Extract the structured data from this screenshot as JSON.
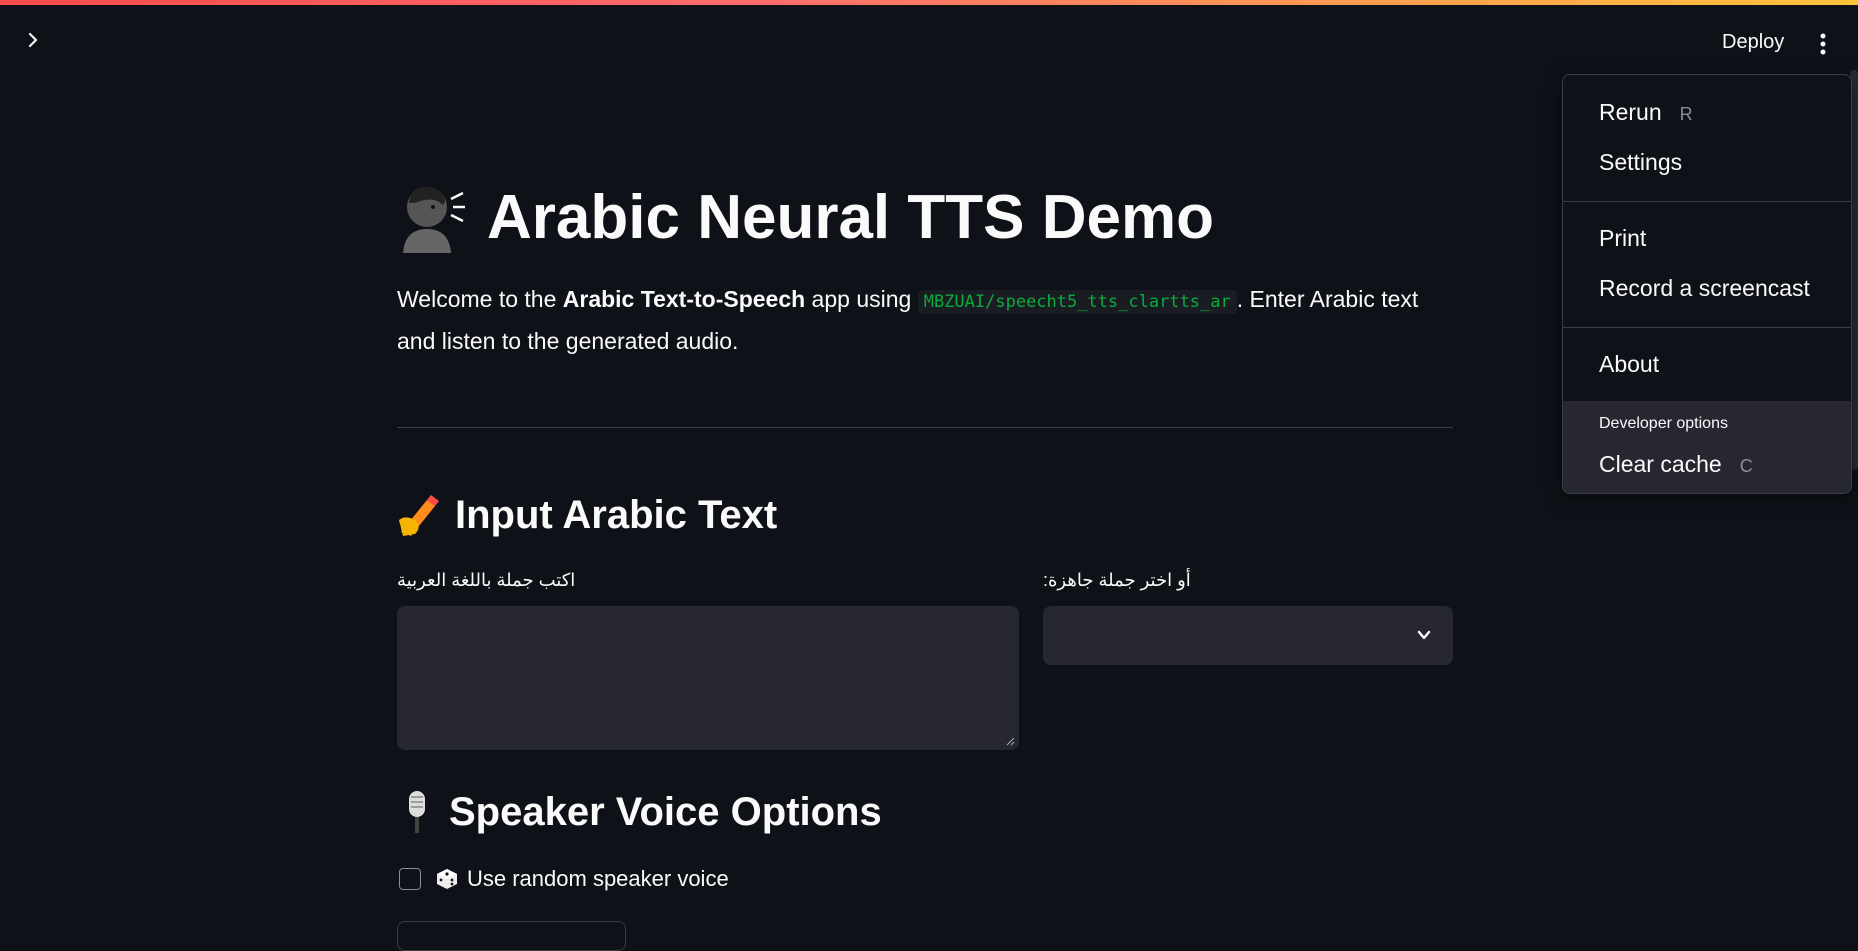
{
  "header": {
    "deploy_label": "Deploy",
    "sidebar_toggle_icon": "chevron-right-icon",
    "menu_icon": "kebab-menu-icon"
  },
  "main": {
    "title_emoji": "speaking-head-icon",
    "title": "Arabic Neural TTS Demo",
    "intro": {
      "prefix": "Welcome to the ",
      "bold": "Arabic Text-to-Speech",
      "middle": " app using ",
      "code": "MBZUAI/speecht5_tts_clartts_ar",
      "suffix": ". Enter Arabic text and listen to the generated audio."
    },
    "input_section": {
      "emoji": "writing-hand-icon",
      "heading": "Input Arabic Text",
      "textarea_label": "اكتب جملة باللغة العربية",
      "textarea_value": "",
      "select_label": "أو اختر جملة جاهزة:",
      "select_value": ""
    },
    "speaker_section": {
      "emoji": "microphone-icon",
      "heading": "Speaker Voice Options",
      "checkbox_emoji": "die-icon",
      "checkbox_label": "Use random speaker voice",
      "checkbox_checked": false
    }
  },
  "menu": {
    "items": [
      {
        "label": "Rerun",
        "shortcut": "R"
      },
      {
        "label": "Settings"
      },
      {
        "label": "Print"
      },
      {
        "label": "Record a screencast"
      },
      {
        "label": "About"
      }
    ],
    "developer_label": "Developer options",
    "clear_cache": {
      "label": "Clear cache",
      "shortcut": "C"
    }
  },
  "colors": {
    "background": "#0e1117",
    "surface": "#262730",
    "code_text": "#09ab3b",
    "accent": "#ff4b4b"
  }
}
